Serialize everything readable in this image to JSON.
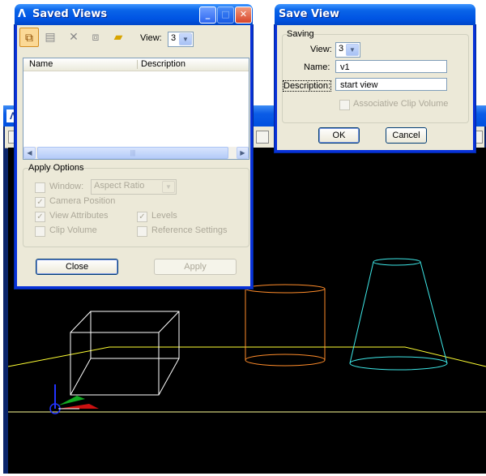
{
  "saved_views": {
    "title": "Saved Views",
    "view_label": "View:",
    "view_value": "3",
    "columns": [
      "Name",
      "Description"
    ],
    "apply_options": {
      "legend": "Apply Options",
      "window_label": "Window:",
      "window_value": "Aspect Ratio",
      "camera_position": "Camera Position",
      "view_attributes": "View Attributes",
      "clip_volume": "Clip Volume",
      "levels": "Levels",
      "reference_settings": "Reference Settings"
    },
    "close_label": "Close",
    "apply_label": "Apply",
    "icons": [
      "save-view-icon",
      "settings-view-icon",
      "delete-icon",
      "copy-view-icon",
      "open-folder-icon"
    ]
  },
  "save_view": {
    "title": "Save View",
    "legend": "Saving",
    "view_label": "View:",
    "view_value": "3",
    "name_label": "Name:",
    "name_value": "v1",
    "description_label": "Description:",
    "description_value": "start view",
    "assoc_clip_label": "Associative Clip Volume",
    "ok_label": "OK",
    "cancel_label": "Cancel"
  },
  "colors": {
    "xp_blue": "#0054e3",
    "dialog_bg": "#ece9d8",
    "viewport_bg": "#000000",
    "box": "#ffffff",
    "cylinder": "#ff8c2a",
    "cone": "#3ee8e8",
    "ground": "#ffff33"
  }
}
